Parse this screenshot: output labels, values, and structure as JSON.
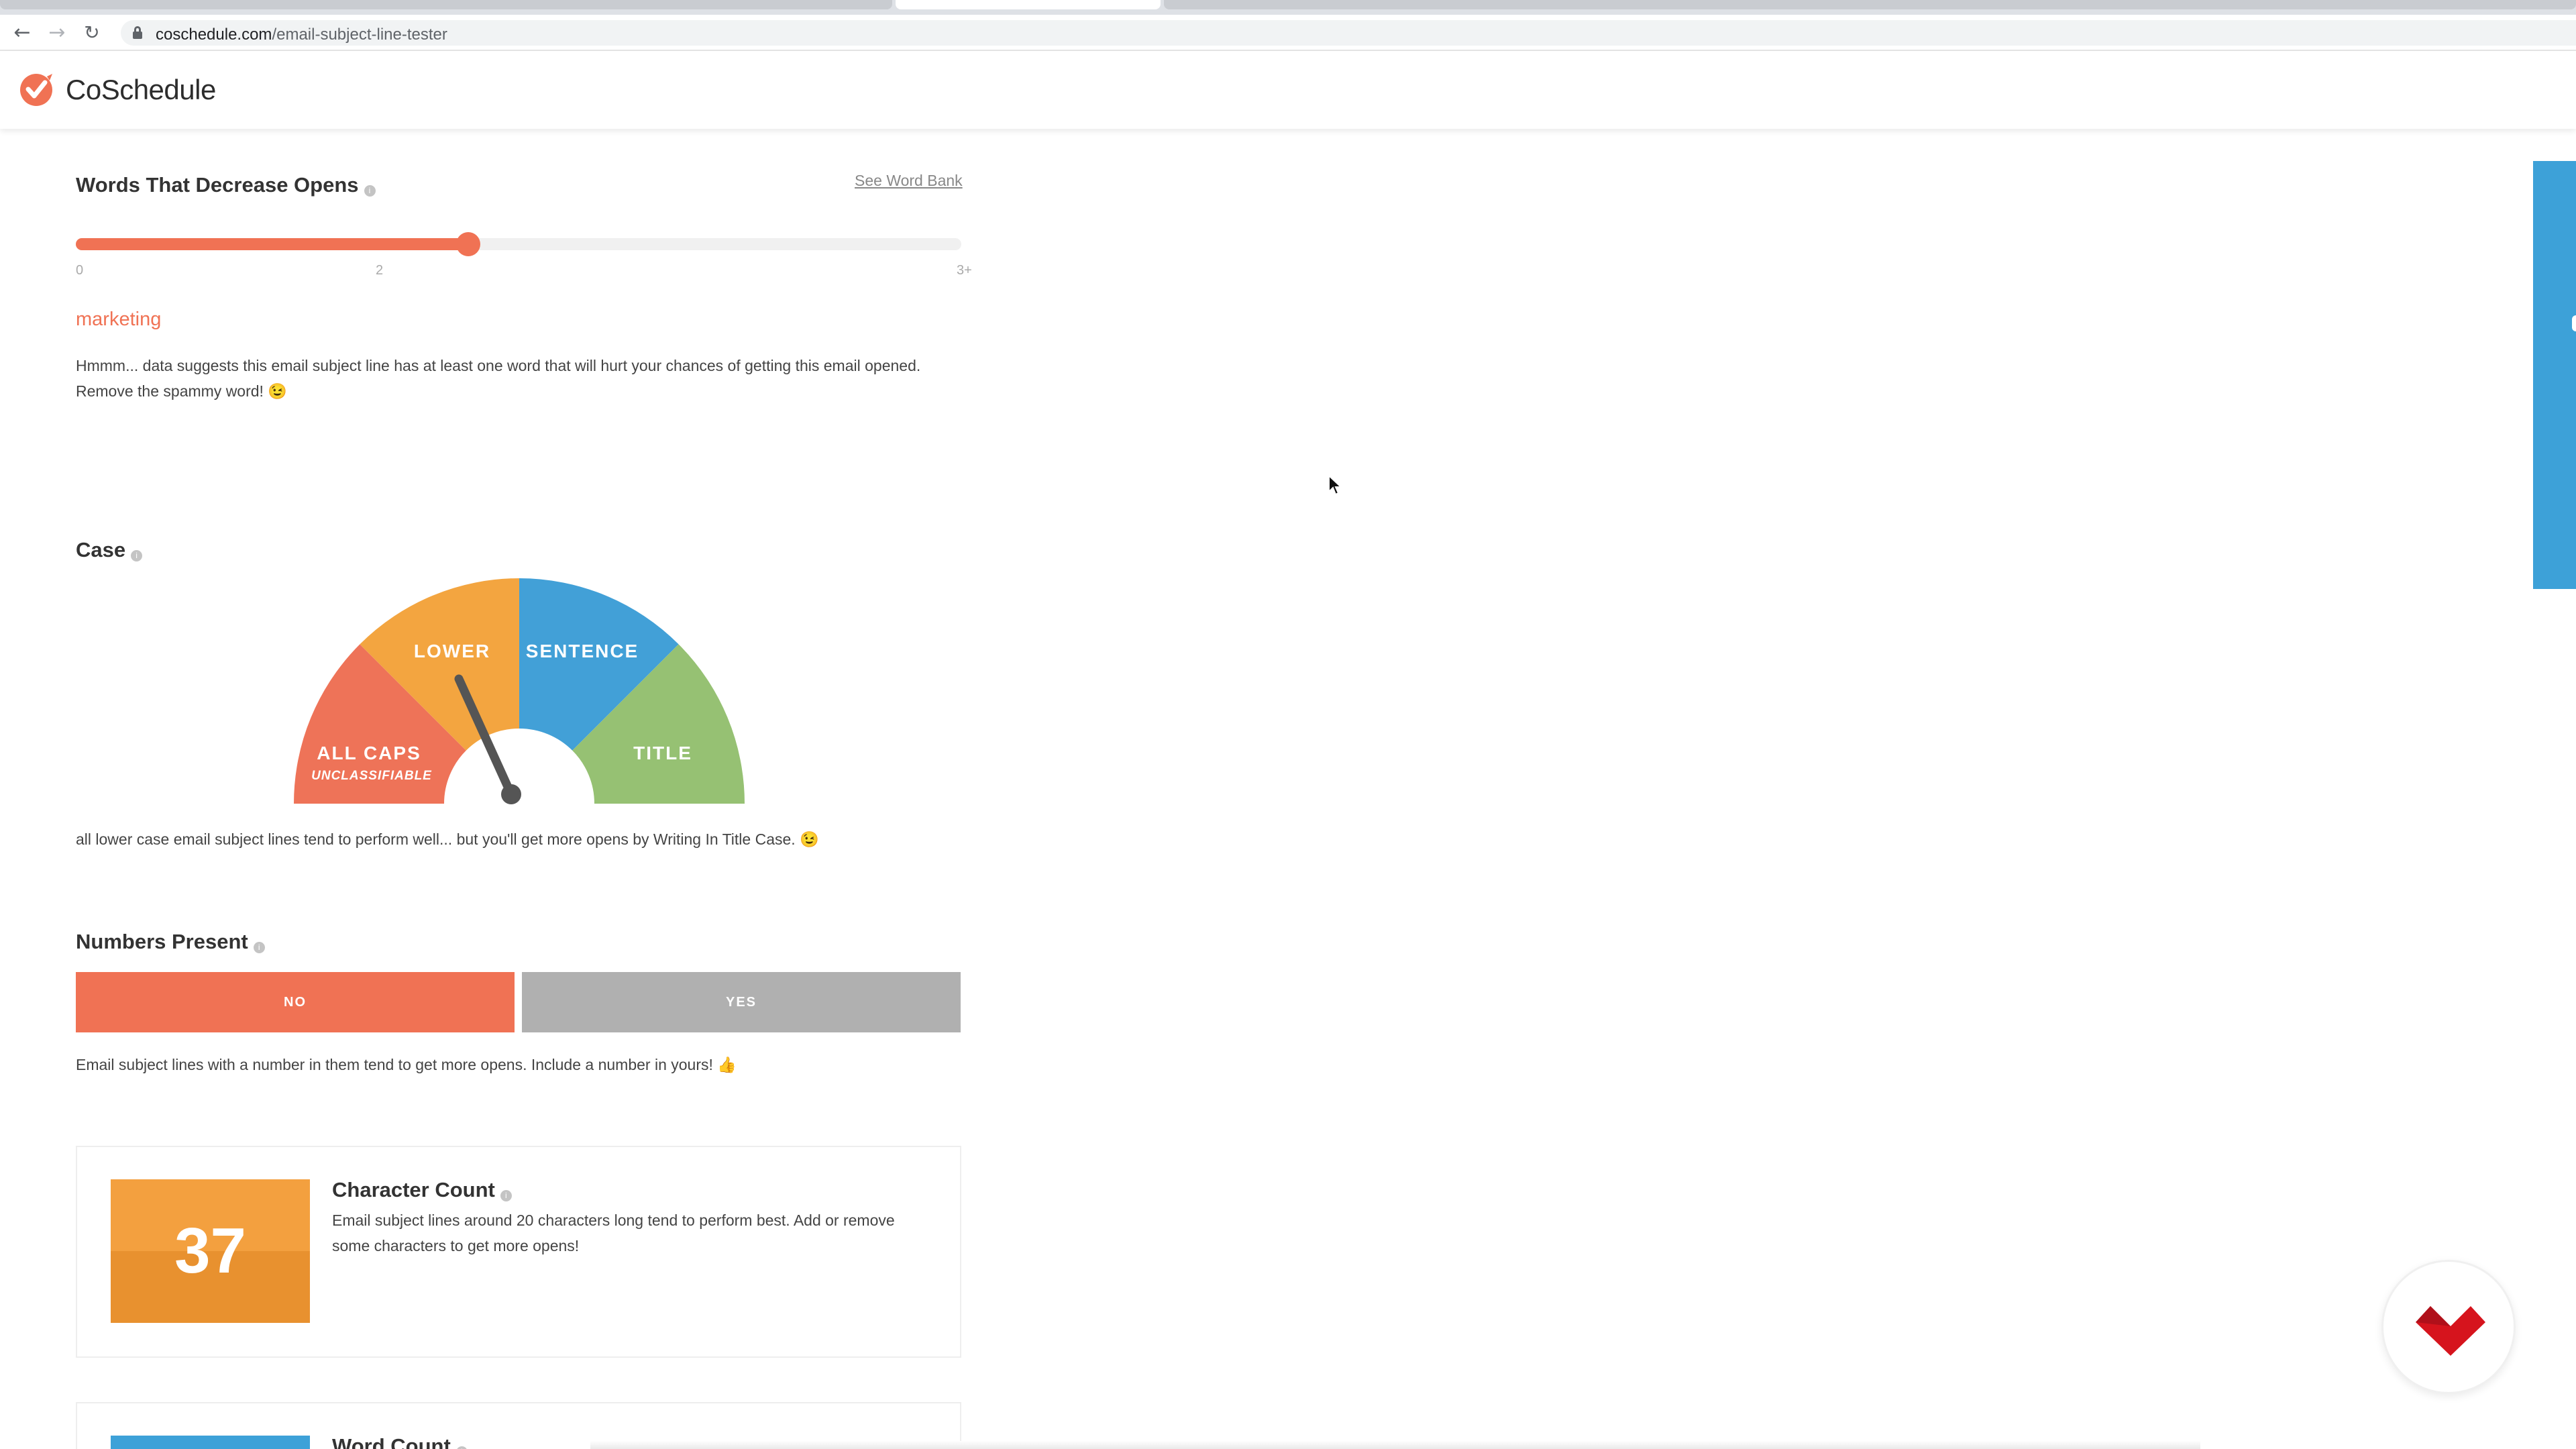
{
  "browser": {
    "url_host": "coschedule.com",
    "url_path": "/email-subject-line-tester"
  },
  "site": {
    "brand": "CoSchedule",
    "accent": "#f07254"
  },
  "words_decrease": {
    "title": "Words That Decrease Opens",
    "link": "See Word Bank",
    "slider": {
      "min_label": "0",
      "mid_label": "2",
      "max_label": "3+",
      "value": 2
    },
    "word": "marketing",
    "message_line1": "Hmmm... data suggests this email subject line has at least one word that will hurt your chances of getting this email opened.",
    "message_line2": "Remove the spammy word! 😉"
  },
  "case": {
    "title": "Case",
    "segments": {
      "all_caps": "ALL CAPS",
      "unclassifiable": "UNCLASSIFIABLE",
      "lower": "LOWER",
      "sentence": "SENTENCE",
      "title": "TITLE"
    },
    "colors": {
      "all_caps": "#ee7358",
      "lower": "#f3a540",
      "sentence": "#42a0d7",
      "title": "#96c173"
    },
    "selected": "LOWER",
    "message": "all lower case email subject lines tend to perform well... but you'll get more opens by Writing In Title Case. 😉"
  },
  "numbers": {
    "title": "Numbers Present",
    "no_label": "NO",
    "yes_label": "YES",
    "selected": "NO",
    "message": "Email subject lines with a number in them tend to get more opens. Include a number in yours! 👍"
  },
  "character_count": {
    "value": "37",
    "title": "Character Count",
    "message": "Email subject lines around 20 characters long tend to perform best. Add or remove some characters to get more opens!"
  },
  "word_count": {
    "title": "Word Count"
  }
}
